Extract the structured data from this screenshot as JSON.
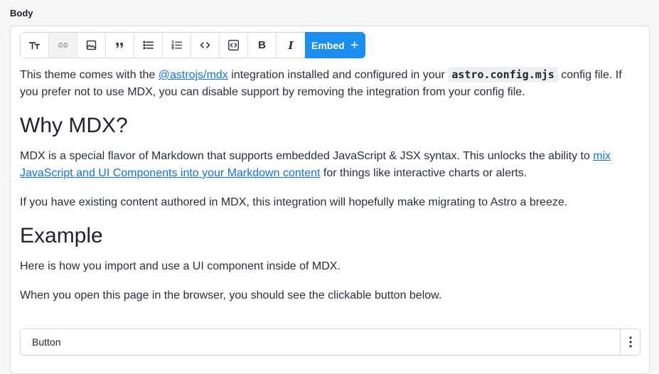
{
  "field": {
    "label": "Body"
  },
  "toolbar": {
    "items": [
      {
        "name": "headings",
        "icon": "text-size-icon"
      },
      {
        "name": "link",
        "icon": "link-icon"
      },
      {
        "name": "image",
        "icon": "image-icon"
      },
      {
        "name": "quote",
        "icon": "quote-icon"
      },
      {
        "name": "bulleted-list",
        "icon": "bulleted-list-icon"
      },
      {
        "name": "numbered-list",
        "icon": "numbered-list-icon"
      },
      {
        "name": "code",
        "icon": "code-icon"
      },
      {
        "name": "code-block",
        "icon": "code-block-icon"
      },
      {
        "name": "bold",
        "label": "B"
      },
      {
        "name": "italic",
        "label": "I"
      }
    ],
    "embed_label": "Embed",
    "embed_plus": "+",
    "accent": "#1b8ff0"
  },
  "content": {
    "p1": {
      "before": "This theme comes with the ",
      "link": "@astrojs/mdx",
      "middle": " integration installed and configured in your ",
      "code": "astro.config.mjs",
      "after": " config file. If you prefer not to use MDX, you can disable support by removing the integration from your config file."
    },
    "h1": "Why MDX?",
    "p2": {
      "before": "MDX is a special flavor of Markdown that supports embedded JavaScript & JSX syntax. This unlocks the ability to ",
      "link": "mix JavaScript and UI Components into your Markdown content",
      "after": " for things like interactive charts or alerts."
    },
    "p3": "If you have existing content authored in MDX, this integration will hopefully make migrating to Astro a breeze.",
    "h2": "Example",
    "p4": "Here is how you import and use a UI component inside of MDX.",
    "p5": "When you open this page in the browser, you should see the clickable button below."
  },
  "component": {
    "label": "Button",
    "menu_icon": "vertical-dots-icon"
  }
}
